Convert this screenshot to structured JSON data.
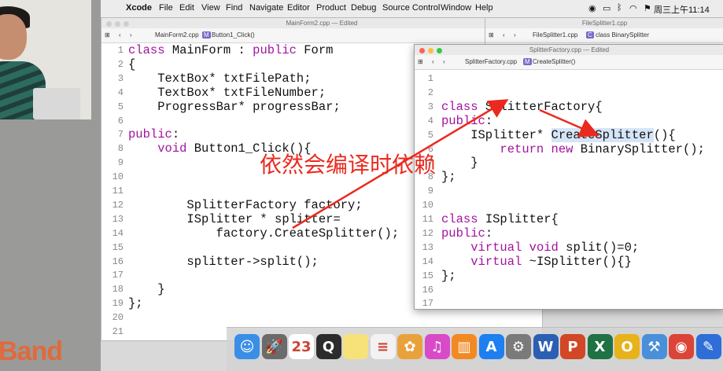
{
  "brand": {
    "text": "Band"
  },
  "menubar": {
    "apple": "",
    "app_name": "Xcode",
    "items": [
      "File",
      "Edit",
      "View",
      "Find",
      "Navigate",
      "Editor",
      "Product",
      "Debug",
      "Source Control",
      "Window",
      "Help"
    ],
    "clock": "周三上午11:14"
  },
  "main_window": {
    "title": "MainForm2.cpp — Edited",
    "breadcrumb_file": "MainForm2.cpp",
    "breadcrumb_method_badge": "M",
    "breadcrumb_method": "Button1_Click()",
    "lines": [
      {
        "n": "1",
        "t": "class MainForm : public Form"
      },
      {
        "n": "2",
        "t": "{"
      },
      {
        "n": "3",
        "t": "    TextBox* txtFilePath;"
      },
      {
        "n": "4",
        "t": "    TextBox* txtFileNumber;"
      },
      {
        "n": "5",
        "t": "    ProgressBar* progressBar;"
      },
      {
        "n": "6",
        "t": ""
      },
      {
        "n": "7",
        "t": "public:"
      },
      {
        "n": "8",
        "t": "    void Button1_Click(){"
      },
      {
        "n": "9",
        "t": ""
      },
      {
        "n": "10",
        "t": ""
      },
      {
        "n": "11",
        "t": ""
      },
      {
        "n": "12",
        "t": "        SplitterFactory factory;"
      },
      {
        "n": "13",
        "t": "        ISplitter * splitter="
      },
      {
        "n": "14",
        "t": "            factory.CreateSplitter();"
      },
      {
        "n": "15",
        "t": ""
      },
      {
        "n": "16",
        "t": "        splitter->split();"
      },
      {
        "n": "17",
        "t": ""
      },
      {
        "n": "18",
        "t": "    }"
      },
      {
        "n": "19",
        "t": "};"
      },
      {
        "n": "20",
        "t": ""
      },
      {
        "n": "21",
        "t": ""
      }
    ]
  },
  "back_window": {
    "title": "FileSplitter1.cpp",
    "breadcrumb_file": "FileSplitter1.cpp",
    "breadcrumb_badge": "C",
    "breadcrumb_class": "class BinarySplitter"
  },
  "front_window": {
    "title": "SplitterFactory.cpp — Edited",
    "breadcrumb_file": "SplitterFactory.cpp",
    "breadcrumb_method_badge": "M",
    "breadcrumb_method": "CreateSplitter()",
    "lines": [
      {
        "n": "1",
        "t": ""
      },
      {
        "n": "2",
        "t": ""
      },
      {
        "n": "3",
        "t": "class SplitterFactory{"
      },
      {
        "n": "4",
        "t": "public:"
      },
      {
        "n": "5",
        "t": "    ISplitter* CreateSplitter(){"
      },
      {
        "n": "6",
        "t": "        return new BinarySplitter();"
      },
      {
        "n": "7",
        "t": "    }"
      },
      {
        "n": "8",
        "t": "};"
      },
      {
        "n": "9",
        "t": ""
      },
      {
        "n": "10",
        "t": ""
      },
      {
        "n": "11",
        "t": "class ISplitter{"
      },
      {
        "n": "12",
        "t": "public:"
      },
      {
        "n": "13",
        "t": "    virtual void split()=0;"
      },
      {
        "n": "14",
        "t": "    virtual ~ISplitter(){}"
      },
      {
        "n": "15",
        "t": "};"
      },
      {
        "n": "16",
        "t": ""
      },
      {
        "n": "17",
        "t": ""
      }
    ]
  },
  "annotation": {
    "text": "依然会编译时依赖",
    "color": "#ea2a1f"
  },
  "dock": {
    "icons": [
      {
        "name": "finder-icon",
        "color": "#3a8ee6",
        "glyph": "☺"
      },
      {
        "name": "launchpad-icon",
        "color": "#6b6b6b",
        "glyph": "🚀"
      },
      {
        "name": "calendar-icon",
        "color": "#ffffff",
        "glyph": "23"
      },
      {
        "name": "quicktime-icon",
        "color": "#2b2b2b",
        "glyph": "Q"
      },
      {
        "name": "notes-icon",
        "color": "#f7e27a",
        "glyph": ""
      },
      {
        "name": "reminders-icon",
        "color": "#f2f2f2",
        "glyph": "≡"
      },
      {
        "name": "photos-icon",
        "color": "#e9a23b",
        "glyph": "✿"
      },
      {
        "name": "itunes-icon",
        "color": "#d84ac8",
        "glyph": "♫"
      },
      {
        "name": "ibooks-icon",
        "color": "#f28a24",
        "glyph": "▥"
      },
      {
        "name": "appstore-icon",
        "color": "#1d7ff0",
        "glyph": "A"
      },
      {
        "name": "system-preferences-icon",
        "color": "#7a7a7a",
        "glyph": "⚙"
      },
      {
        "name": "word-icon",
        "color": "#2b5fb3",
        "glyph": "W"
      },
      {
        "name": "powerpoint-icon",
        "color": "#d24726",
        "glyph": "P"
      },
      {
        "name": "excel-icon",
        "color": "#1f7244",
        "glyph": "X"
      },
      {
        "name": "onenote-icon",
        "color": "#e8b21b",
        "glyph": "O"
      },
      {
        "name": "xcode-icon",
        "color": "#4a8fd9",
        "glyph": "⚒"
      },
      {
        "name": "chrome-icon",
        "color": "#db4437",
        "glyph": "◉"
      },
      {
        "name": "xcode-dev-icon",
        "color": "#2e6ed6",
        "glyph": "✎"
      },
      {
        "name": "folder-icon",
        "color": "#6aaee8",
        "glyph": "▭"
      },
      {
        "name": "trash-icon",
        "color": "#dcdcdc",
        "glyph": "🗑"
      }
    ]
  }
}
